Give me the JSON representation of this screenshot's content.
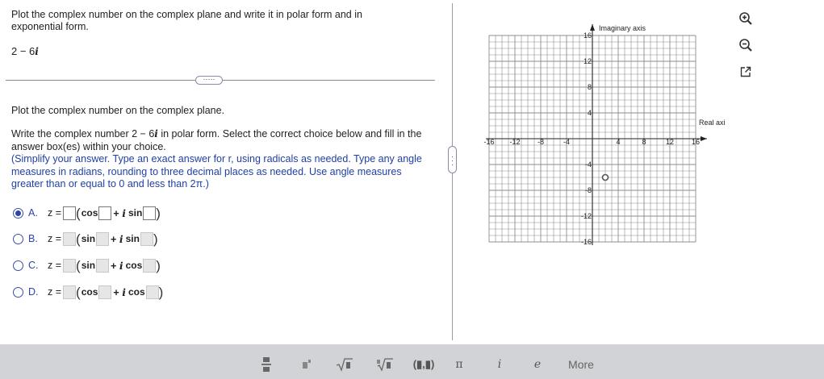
{
  "question": {
    "prompt": "Plot the complex number on the complex plane and write it in polar form and in exponential form.",
    "number_real": "2 − 6",
    "number_imag": "i"
  },
  "divider_pill": "·····",
  "part": {
    "plot_instruction": "Plot the complex number on the complex plane.",
    "write_a": "Write the complex number 2 − 6",
    "write_b": " in polar form. Select the correct choice below and fill in the answer box(es) within your choice.",
    "hint": "(Simplify your answer. Type an exact answer for r, using radicals as needed. Type any angle measures in radians, rounding to three decimal places as needed. Use angle measures greater than or equal to 0 and less than 2π.)"
  },
  "choices": [
    {
      "letter": "A.",
      "z": "z =",
      "f1": "cos",
      "plus": "+",
      "i": "i",
      "f2": "sin",
      "selected": true
    },
    {
      "letter": "B.",
      "z": "z =",
      "f1": "sin",
      "plus": "+",
      "i": "i",
      "f2": "sin",
      "selected": false
    },
    {
      "letter": "C.",
      "z": "z =",
      "f1": "sin",
      "plus": "+",
      "i": "i",
      "f2": "cos",
      "selected": false
    },
    {
      "letter": "D.",
      "z": "z =",
      "f1": "cos",
      "plus": "+",
      "i": "i",
      "f2": "cos",
      "selected": false
    }
  ],
  "graph": {
    "y_axis_label": "Imaginary axis",
    "x_axis_label": "Real axis",
    "x_range": [
      -16,
      16
    ],
    "y_range": [
      -16,
      16
    ],
    "x_ticks": [
      "-16",
      "-12",
      "-8",
      "-4",
      "4",
      "8",
      "12",
      "16"
    ],
    "y_ticks": [
      "16",
      "12",
      "8",
      "4",
      "-4",
      "-8",
      "-12",
      "-16"
    ],
    "point": {
      "x": 2,
      "y": -6
    },
    "grid_color": "#8c8c8c",
    "point_color": "#555555"
  },
  "toolbar": {
    "buttons": [
      "fraction",
      "mixed-number",
      "sqrt",
      "nth-root",
      "ordered-pair",
      "π",
      "i",
      "e"
    ],
    "pi": "π",
    "i": "i",
    "e": "e",
    "pair": "(▮,▮)",
    "more": "More"
  }
}
